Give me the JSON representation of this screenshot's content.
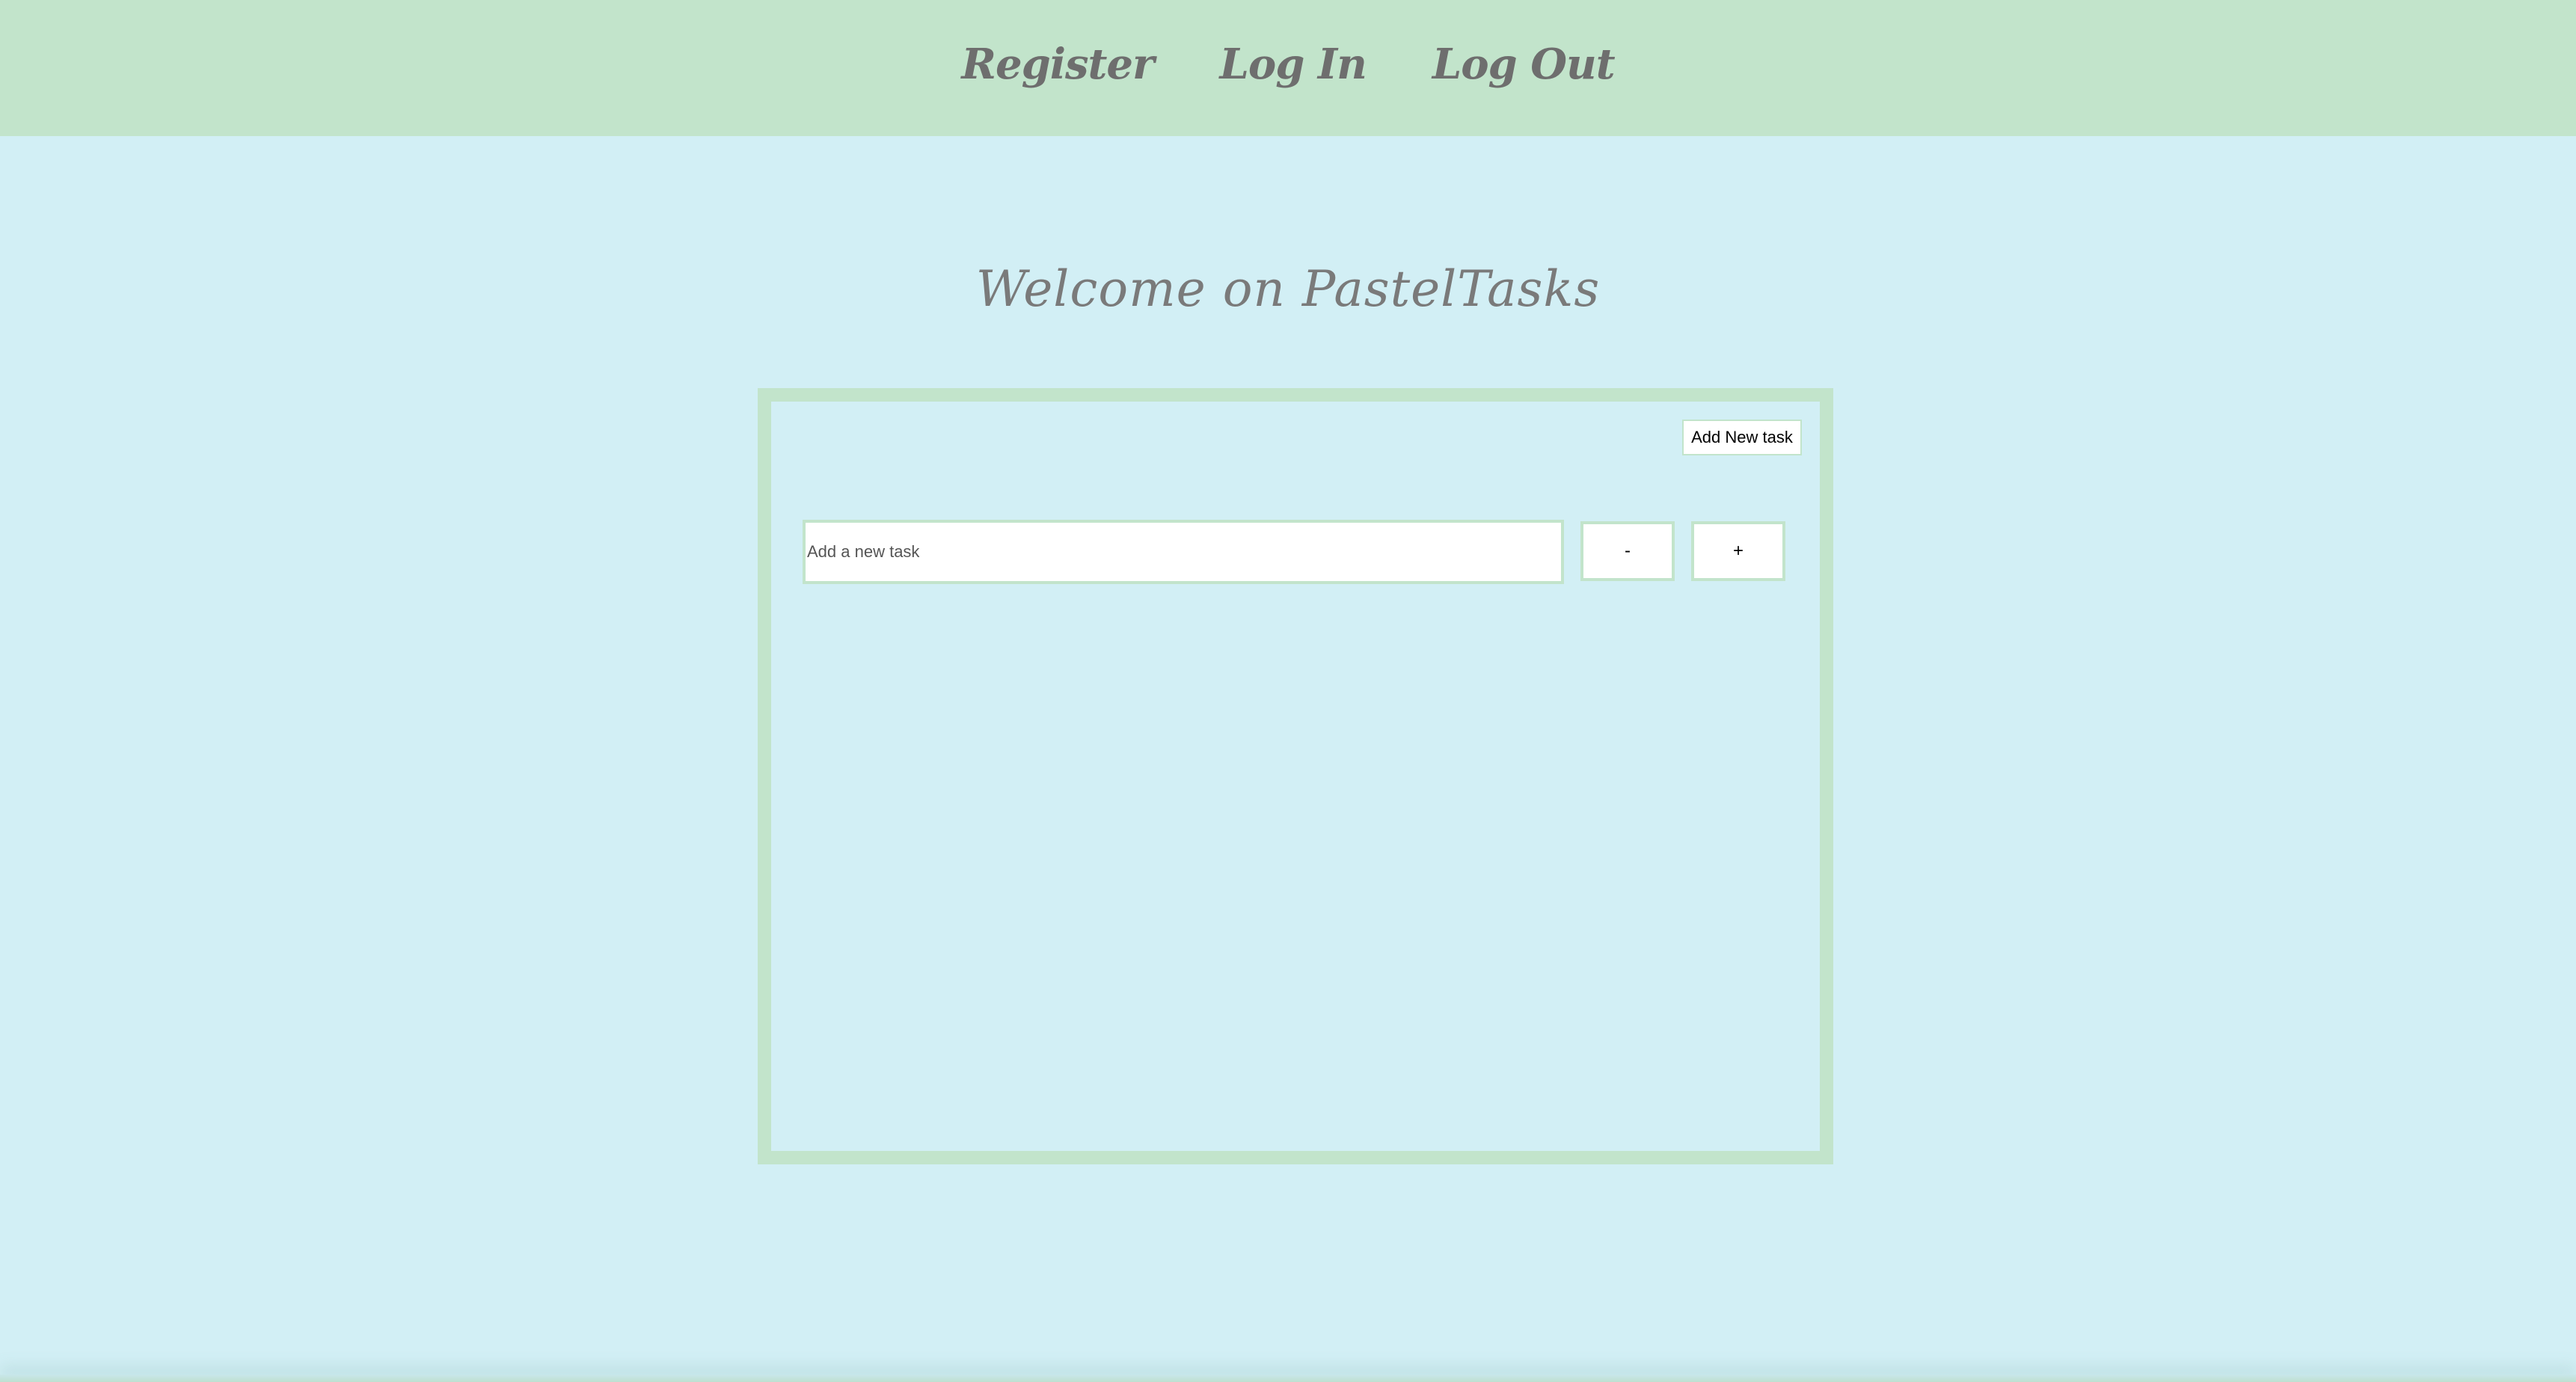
{
  "nav": {
    "items": [
      {
        "label": "Register"
      },
      {
        "label": "Log In"
      },
      {
        "label": "Log Out"
      }
    ]
  },
  "main": {
    "title": "Welcome on PastelTasks"
  },
  "task_panel": {
    "add_new_label": "Add New task",
    "input": {
      "value": "",
      "placeholder": "Add a new task"
    },
    "minus_label": "-",
    "plus_label": "+"
  },
  "colors": {
    "navbar": "#c2e4cb",
    "background": "#d2eff5",
    "panel_border": "#c2e4cb",
    "nav_text": "#6e6e6e"
  }
}
